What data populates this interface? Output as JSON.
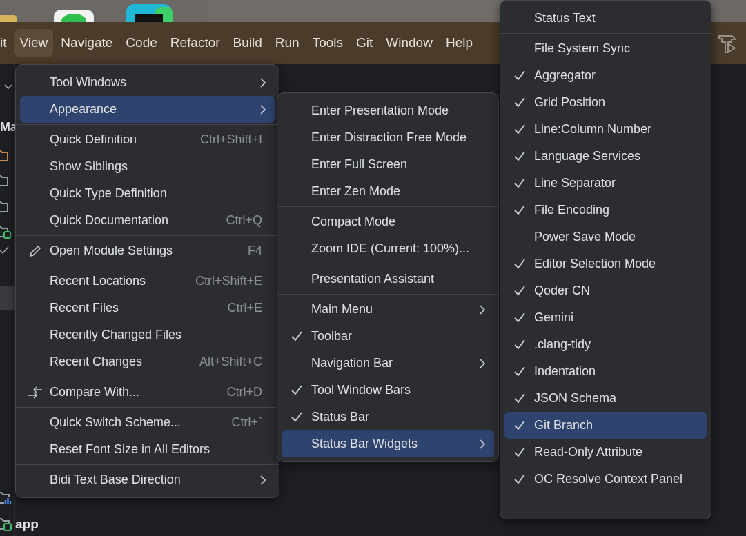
{
  "menu_bar": {
    "items": [
      {
        "label": "it",
        "selected": false
      },
      {
        "label": "View",
        "selected": true
      },
      {
        "label": "Navigate",
        "selected": false
      },
      {
        "label": "Code",
        "selected": false
      },
      {
        "label": "Refactor",
        "selected": false
      },
      {
        "label": "Build",
        "selected": false
      },
      {
        "label": "Run",
        "selected": false
      },
      {
        "label": "Tools",
        "selected": false
      },
      {
        "label": "Git",
        "selected": false
      },
      {
        "label": "Window",
        "selected": false
      },
      {
        "label": "Help",
        "selected": false
      }
    ]
  },
  "project_panel": {
    "title": "Ma",
    "items": [
      {
        "label": "app"
      }
    ]
  },
  "menus": [
    {
      "groups": [
        [
          {
            "label": "Tool Windows",
            "submenu": true,
            "selected": false
          },
          {
            "label": "Appearance",
            "submenu": true,
            "selected": true
          }
        ],
        [
          {
            "label": "Quick Definition",
            "shortcut": "Ctrl+Shift+I",
            "selected": false
          },
          {
            "label": "Show Siblings",
            "selected": false
          },
          {
            "label": "Quick Type Definition",
            "selected": false
          },
          {
            "label": "Quick Documentation",
            "shortcut": "Ctrl+Q",
            "selected": false
          }
        ],
        [
          {
            "label": "Open Module Settings",
            "kind": "edit",
            "shortcut": "F4",
            "selected": false
          }
        ],
        [
          {
            "label": "Recent Locations",
            "shortcut": "Ctrl+Shift+E",
            "selected": false
          },
          {
            "label": "Recent Files",
            "shortcut": "Ctrl+E",
            "selected": false
          },
          {
            "label": "Recently Changed Files",
            "selected": false
          },
          {
            "label": "Recent Changes",
            "shortcut": "Alt+Shift+C",
            "selected": false
          }
        ],
        [
          {
            "label": "Compare With...",
            "kind": "compare",
            "shortcut": "Ctrl+D",
            "selected": false
          }
        ],
        [
          {
            "label": "Quick Switch Scheme...",
            "shortcut": "Ctrl+`",
            "selected": false
          },
          {
            "label": "Reset Font Size in All Editors",
            "selected": false
          }
        ],
        [
          {
            "label": "Bidi Text Base Direction",
            "submenu": true,
            "selected": false
          }
        ]
      ]
    },
    {
      "groups": [
        [
          {
            "label": "Enter Presentation Mode",
            "checked": false,
            "selected": false
          },
          {
            "label": "Enter Distraction Free Mode",
            "checked": false,
            "selected": false
          },
          {
            "label": "Enter Full Screen",
            "checked": false,
            "selected": false
          },
          {
            "label": "Enter Zen Mode",
            "checked": false,
            "selected": false
          }
        ],
        [
          {
            "label": "Compact Mode",
            "checked": false,
            "selected": false
          },
          {
            "label": "Zoom IDE (Current: 100%)...",
            "checked": false,
            "selected": false
          }
        ],
        [
          {
            "label": "Presentation Assistant",
            "checked": false,
            "selected": false
          }
        ],
        [
          {
            "label": "Main Menu",
            "submenu": true,
            "checked": false,
            "selected": false
          },
          {
            "label": "Toolbar",
            "checked": true,
            "selected": false
          },
          {
            "label": "Navigation Bar",
            "submenu": true,
            "checked": false,
            "selected": false
          },
          {
            "label": "Tool Window Bars",
            "checked": true,
            "selected": false
          },
          {
            "label": "Status Bar",
            "checked": true,
            "selected": false
          },
          {
            "label": "Status Bar Widgets",
            "submenu": true,
            "checked": false,
            "selected": true
          }
        ]
      ]
    },
    {
      "groups": [
        [
          {
            "label": "Status Text",
            "checked": false,
            "selected": false
          }
        ],
        [
          {
            "label": "File System Sync",
            "checked": false,
            "selected": false
          },
          {
            "label": "Aggregator",
            "checked": true,
            "selected": false
          },
          {
            "label": "Grid Position",
            "checked": true,
            "selected": false
          },
          {
            "label": "Line:Column Number",
            "checked": true,
            "selected": false
          },
          {
            "label": "Language Services",
            "checked": true,
            "selected": false
          },
          {
            "label": "Line Separator",
            "checked": true,
            "selected": false
          },
          {
            "label": "File Encoding",
            "checked": true,
            "selected": false
          },
          {
            "label": "Power Save Mode",
            "checked": false,
            "selected": false
          },
          {
            "label": "Editor Selection Mode",
            "checked": true,
            "selected": false
          },
          {
            "label": "Qoder CN",
            "checked": true,
            "selected": false
          },
          {
            "label": "Gemini",
            "checked": true,
            "selected": false
          },
          {
            "label": ".clang-tidy",
            "checked": true,
            "selected": false
          },
          {
            "label": "Indentation",
            "checked": true,
            "selected": false
          },
          {
            "label": "JSON Schema",
            "checked": true,
            "selected": false
          },
          {
            "label": "Git Branch",
            "checked": true,
            "selected": true
          },
          {
            "label": "Read-Only Attribute",
            "checked": true,
            "selected": false
          },
          {
            "label": "OC Resolve Context Panel",
            "checked": true,
            "selected": false
          }
        ]
      ]
    }
  ]
}
